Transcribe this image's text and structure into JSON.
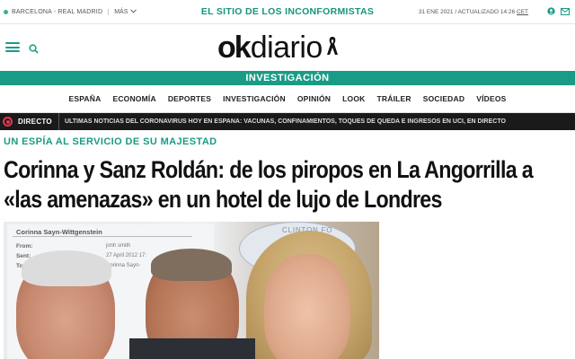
{
  "topbar": {
    "live_match": "BARCELONA - REAL MADRID",
    "more_label": "MÁS",
    "slogan": "EL SITIO DE LOS INCONFORMISTAS",
    "date": "31 ENE 2021 / ACTUALIZADO 14:26",
    "timezone": "CET"
  },
  "header": {
    "logo_ok": "ok",
    "logo_diario": "diario"
  },
  "section_band": "INVESTIGACIÓN",
  "nav": {
    "items": [
      "ESPAÑA",
      "ECONOMÍA",
      "DEPORTES",
      "INVESTIGACIÓN",
      "OPINIÓN",
      "LOOK",
      "TRÁILER",
      "SOCIEDAD",
      "VÍDEOS"
    ]
  },
  "ticker": {
    "label": "DIRECTO",
    "text": "ÚLTIMAS NOTICIAS DEL CORONAVIRUS HOY EN ESPAÑA: VACUNAS, CONFINAMIENTOS, TOQUES DE QUEDA E INGRESOS EN UCI, EN DIRECTO"
  },
  "article": {
    "kicker": "UN ESPÍA AL SERVICIO DE SU MAJESTAD",
    "headline": "Corinna y Sanz Roldán: de los piropos en La Angorrilla a «las amenazas» en un hotel de lujo de Londres"
  },
  "hero": {
    "email_name": "Corinna Sayn-Wittgenstein",
    "from_label": "From:",
    "sent_label": "Sent:",
    "to_label": "To:",
    "from_value": "jonh smith",
    "sent_value": "27 April 2012 17:",
    "to_value": "Corinna Sayn-",
    "foundation_text": "CLINTON FO"
  },
  "colors": {
    "brand": "#1a9b85",
    "live_red": "#e8374f"
  },
  "icons": [
    "green-dot-icon",
    "chevron-down-icon",
    "user-icon",
    "mail-icon",
    "hamburger-menu-icon",
    "search-icon",
    "mourning-ribbon-icon",
    "live-icon"
  ]
}
